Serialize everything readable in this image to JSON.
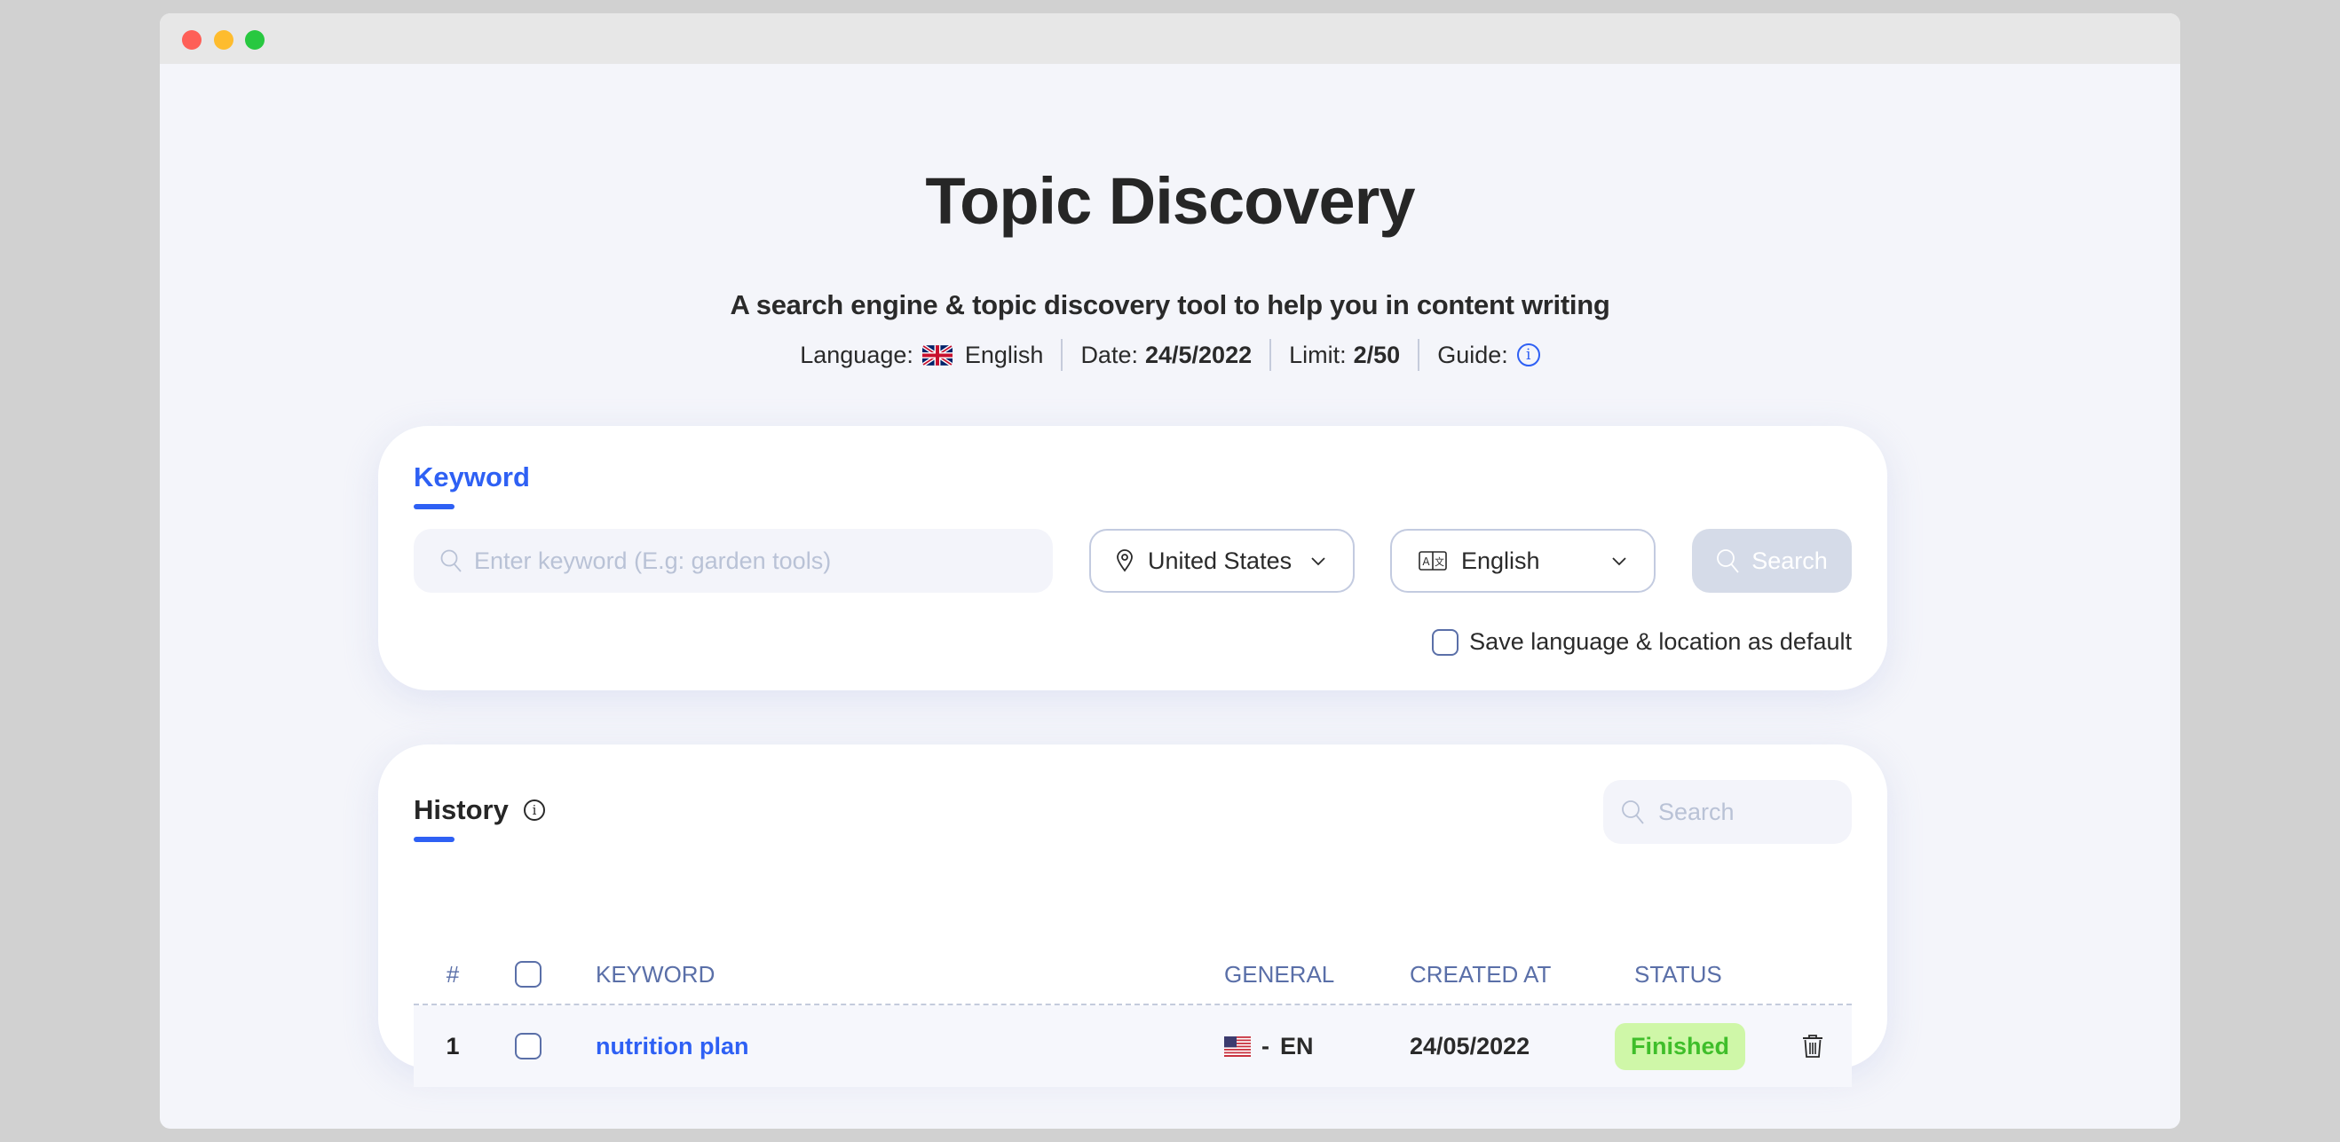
{
  "window": {
    "controls": [
      "close",
      "minimize",
      "maximize"
    ]
  },
  "header": {
    "title": "Topic Discovery",
    "subtitle": "A search engine & topic discovery tool to help you in content writing",
    "meta": {
      "language_label": "Language:",
      "language_flag": "uk-flag-icon",
      "language_value": "English",
      "date_label": "Date:",
      "date_value": "24/5/2022",
      "limit_label": "Limit:",
      "limit_value": "2/50",
      "guide_label": "Guide:",
      "guide_icon": "info-icon"
    }
  },
  "keyword_card": {
    "tab_label": "Keyword",
    "keyword_input": {
      "value": "",
      "placeholder": "Enter keyword (E.g: garden tools)",
      "icon": "search-icon"
    },
    "location_select": {
      "value": "United States",
      "icon": "map-pin-icon"
    },
    "language_select": {
      "value": "English",
      "icon": "translate-icon"
    },
    "search_button": {
      "label": "Search",
      "icon": "search-icon",
      "disabled": true
    },
    "save_default": {
      "label": "Save language & location as default",
      "checked": false
    }
  },
  "history_card": {
    "title": "History",
    "info_icon": "info-icon",
    "search": {
      "value": "",
      "placeholder": "Search"
    },
    "columns": [
      "#",
      "",
      "KEYWORD",
      "GENERAL",
      "CREATED AT",
      "STATUS",
      ""
    ],
    "rows": [
      {
        "index": "1",
        "checked": false,
        "keyword": "nutrition plan",
        "general_flag": "us-flag-icon",
        "general_sep": "-",
        "general_lang": "EN",
        "created_at": "24/05/2022",
        "status": "Finished",
        "action_icon": "trash-icon"
      }
    ]
  },
  "colors": {
    "accent": "#2e60f4",
    "status_finished_bg": "#cff7a8",
    "status_finished_text": "#3fbe2a",
    "header_text": "#5a6fa8",
    "disabled_button": "#d5dbe8"
  }
}
